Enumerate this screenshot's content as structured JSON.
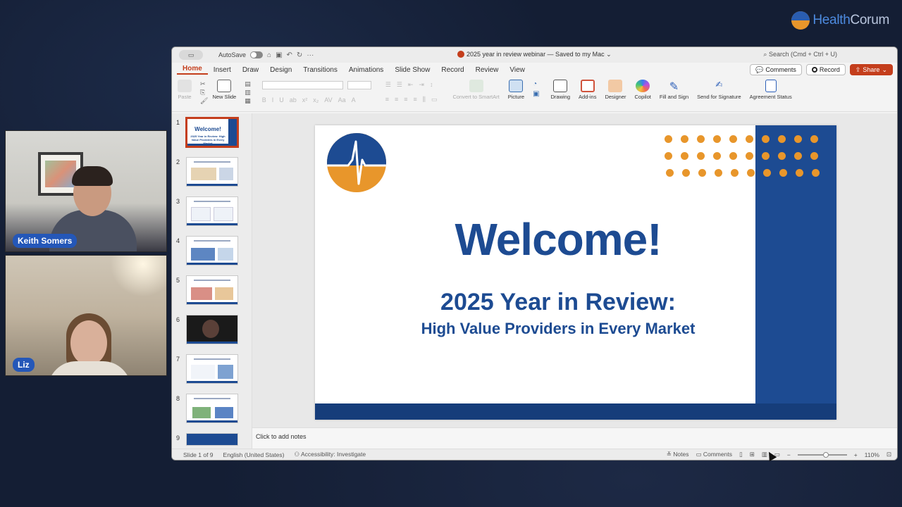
{
  "brand": {
    "name_part1": "Health",
    "name_part2": "Corum"
  },
  "participants": [
    {
      "name": "Keith Somers"
    },
    {
      "name": "Liz"
    }
  ],
  "window": {
    "autosave_label": "AutoSave",
    "title": "2025 year in review webinar — Saved to my Mac ⌄",
    "search_placeholder": "Search (Cmd + Ctrl + U)"
  },
  "menu": {
    "tabs": [
      "Home",
      "Insert",
      "Draw",
      "Design",
      "Transitions",
      "Animations",
      "Slide Show",
      "Record",
      "Review",
      "View"
    ],
    "active_tab": "Home",
    "comments_label": "Comments",
    "record_label": "Record",
    "share_label": "Share"
  },
  "ribbon": {
    "paste": "Paste",
    "new_slide": "New Slide",
    "convert_smartart": "Convert to SmartArt",
    "picture": "Picture",
    "drawing": "Drawing",
    "addins": "Add-ins",
    "designer": "Designer",
    "copilot": "Copilot",
    "fill_sign": "Fill and Sign",
    "send_signature": "Send for Signature",
    "agreement_status": "Agreement Status"
  },
  "thumbnails": {
    "numbers": [
      "1",
      "2",
      "3",
      "4",
      "5",
      "6",
      "7",
      "8",
      "9"
    ],
    "mini_title": "Welcome!",
    "mini_subtitle": "2025 Year in Review: High Value Providers in Every Market"
  },
  "slide": {
    "title": "Welcome!",
    "subtitle": "2025 Year in Review:",
    "tagline": "High Value Providers in Every Market"
  },
  "notes_placeholder": "Click to add notes",
  "status": {
    "slide_of": "Slide 1 of 9",
    "language": "English (United States)",
    "accessibility": "Accessibility: Investigate",
    "notes": "Notes",
    "comments": "Comments",
    "zoom": "110%"
  },
  "colors": {
    "brand_blue": "#1d4b92",
    "brand_orange": "#e8962b",
    "office_red": "#c43e1c",
    "participant_tag": "#2457b8"
  }
}
